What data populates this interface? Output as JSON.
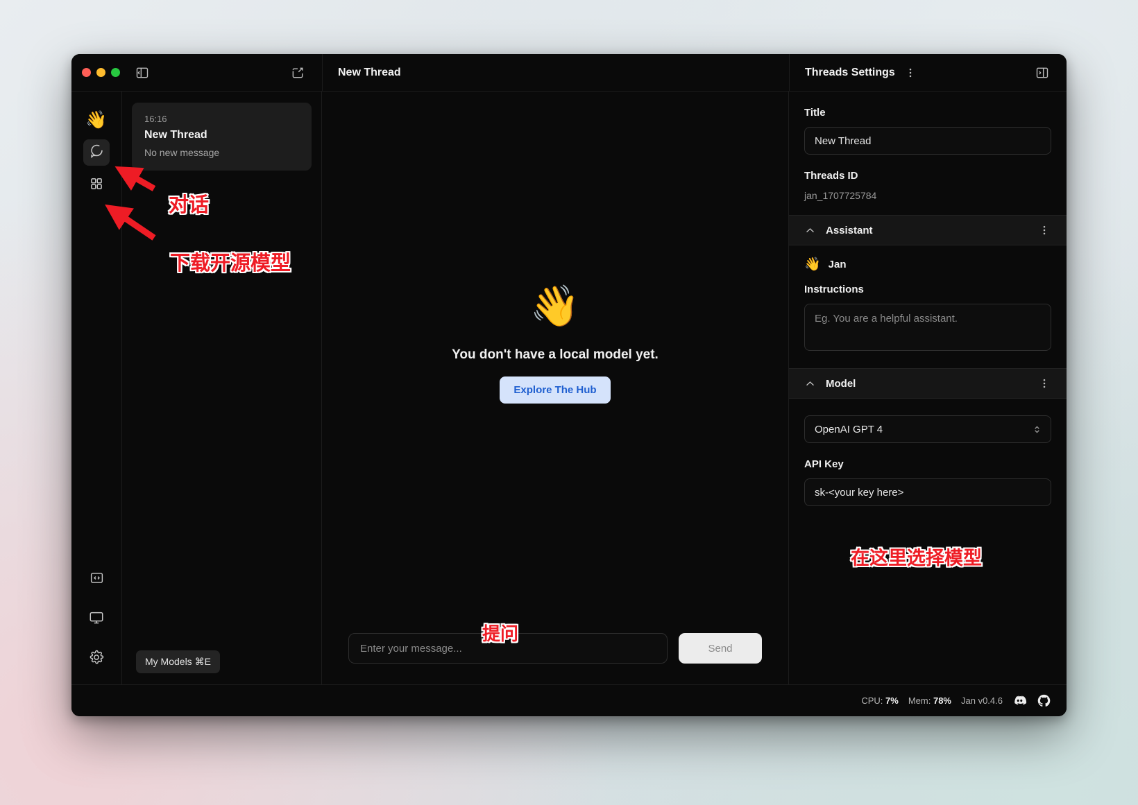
{
  "window": {
    "traffic_lights": [
      "close",
      "minimize",
      "maximize"
    ]
  },
  "titlebar": {
    "collapse_left_icon": "panel-collapse-left-icon",
    "compose_icon": "compose-icon",
    "center_title": "New Thread",
    "settings_title": "Threads Settings",
    "settings_more_icon": "more-vertical-icon",
    "collapse_right_icon": "panel-collapse-right-icon"
  },
  "rail": {
    "logo_emoji": "👋",
    "items": [
      {
        "name": "sidebar-item-chat",
        "icon": "chat-bubble-icon",
        "active": true
      },
      {
        "name": "sidebar-item-hub",
        "icon": "grid-icon",
        "active": false
      }
    ],
    "bottom_items": [
      {
        "name": "sidebar-item-code",
        "icon": "code-brackets-icon"
      },
      {
        "name": "sidebar-item-system-monitor",
        "icon": "monitor-icon"
      },
      {
        "name": "sidebar-item-settings",
        "icon": "gear-icon"
      }
    ]
  },
  "threads": {
    "items": [
      {
        "time": "16:16",
        "title": "New Thread",
        "subtitle": "No new message"
      }
    ],
    "my_models_label": "My Models ⌘E"
  },
  "chat": {
    "empty_emoji": "👋",
    "empty_title": "You don't have a local model yet.",
    "explore_button": "Explore The Hub",
    "input_placeholder": "Enter your message...",
    "input_value": "",
    "send_label": "Send"
  },
  "settings": {
    "title_label": "Title",
    "title_value": "New Thread",
    "threads_id_label": "Threads ID",
    "threads_id_value": "jan_1707725784",
    "assistant_section": "Assistant",
    "assistant_emoji": "👋",
    "assistant_name": "Jan",
    "instructions_label": "Instructions",
    "instructions_placeholder": "Eg. You are a helpful assistant.",
    "instructions_value": "",
    "model_section": "Model",
    "model_value": "OpenAI GPT 4",
    "api_key_label": "API Key",
    "api_key_value": "sk-<your key here>"
  },
  "statusbar": {
    "cpu_label": "CPU:",
    "cpu_value": "7%",
    "mem_label": "Mem:",
    "mem_value": "78%",
    "version": "Jan v0.4.6",
    "discord_icon": "discord-icon",
    "github_icon": "github-icon"
  },
  "annotations": {
    "chat_label": "对话",
    "download_model_label": "下载开源模型",
    "ask_label": "提问",
    "select_model_label": "在这里选择模型"
  },
  "colors": {
    "accent_red": "#ee1c25",
    "explore_bg": "#d5e3fb",
    "explore_fg": "#1f5fd0",
    "window_bg": "#0a0a0a"
  }
}
